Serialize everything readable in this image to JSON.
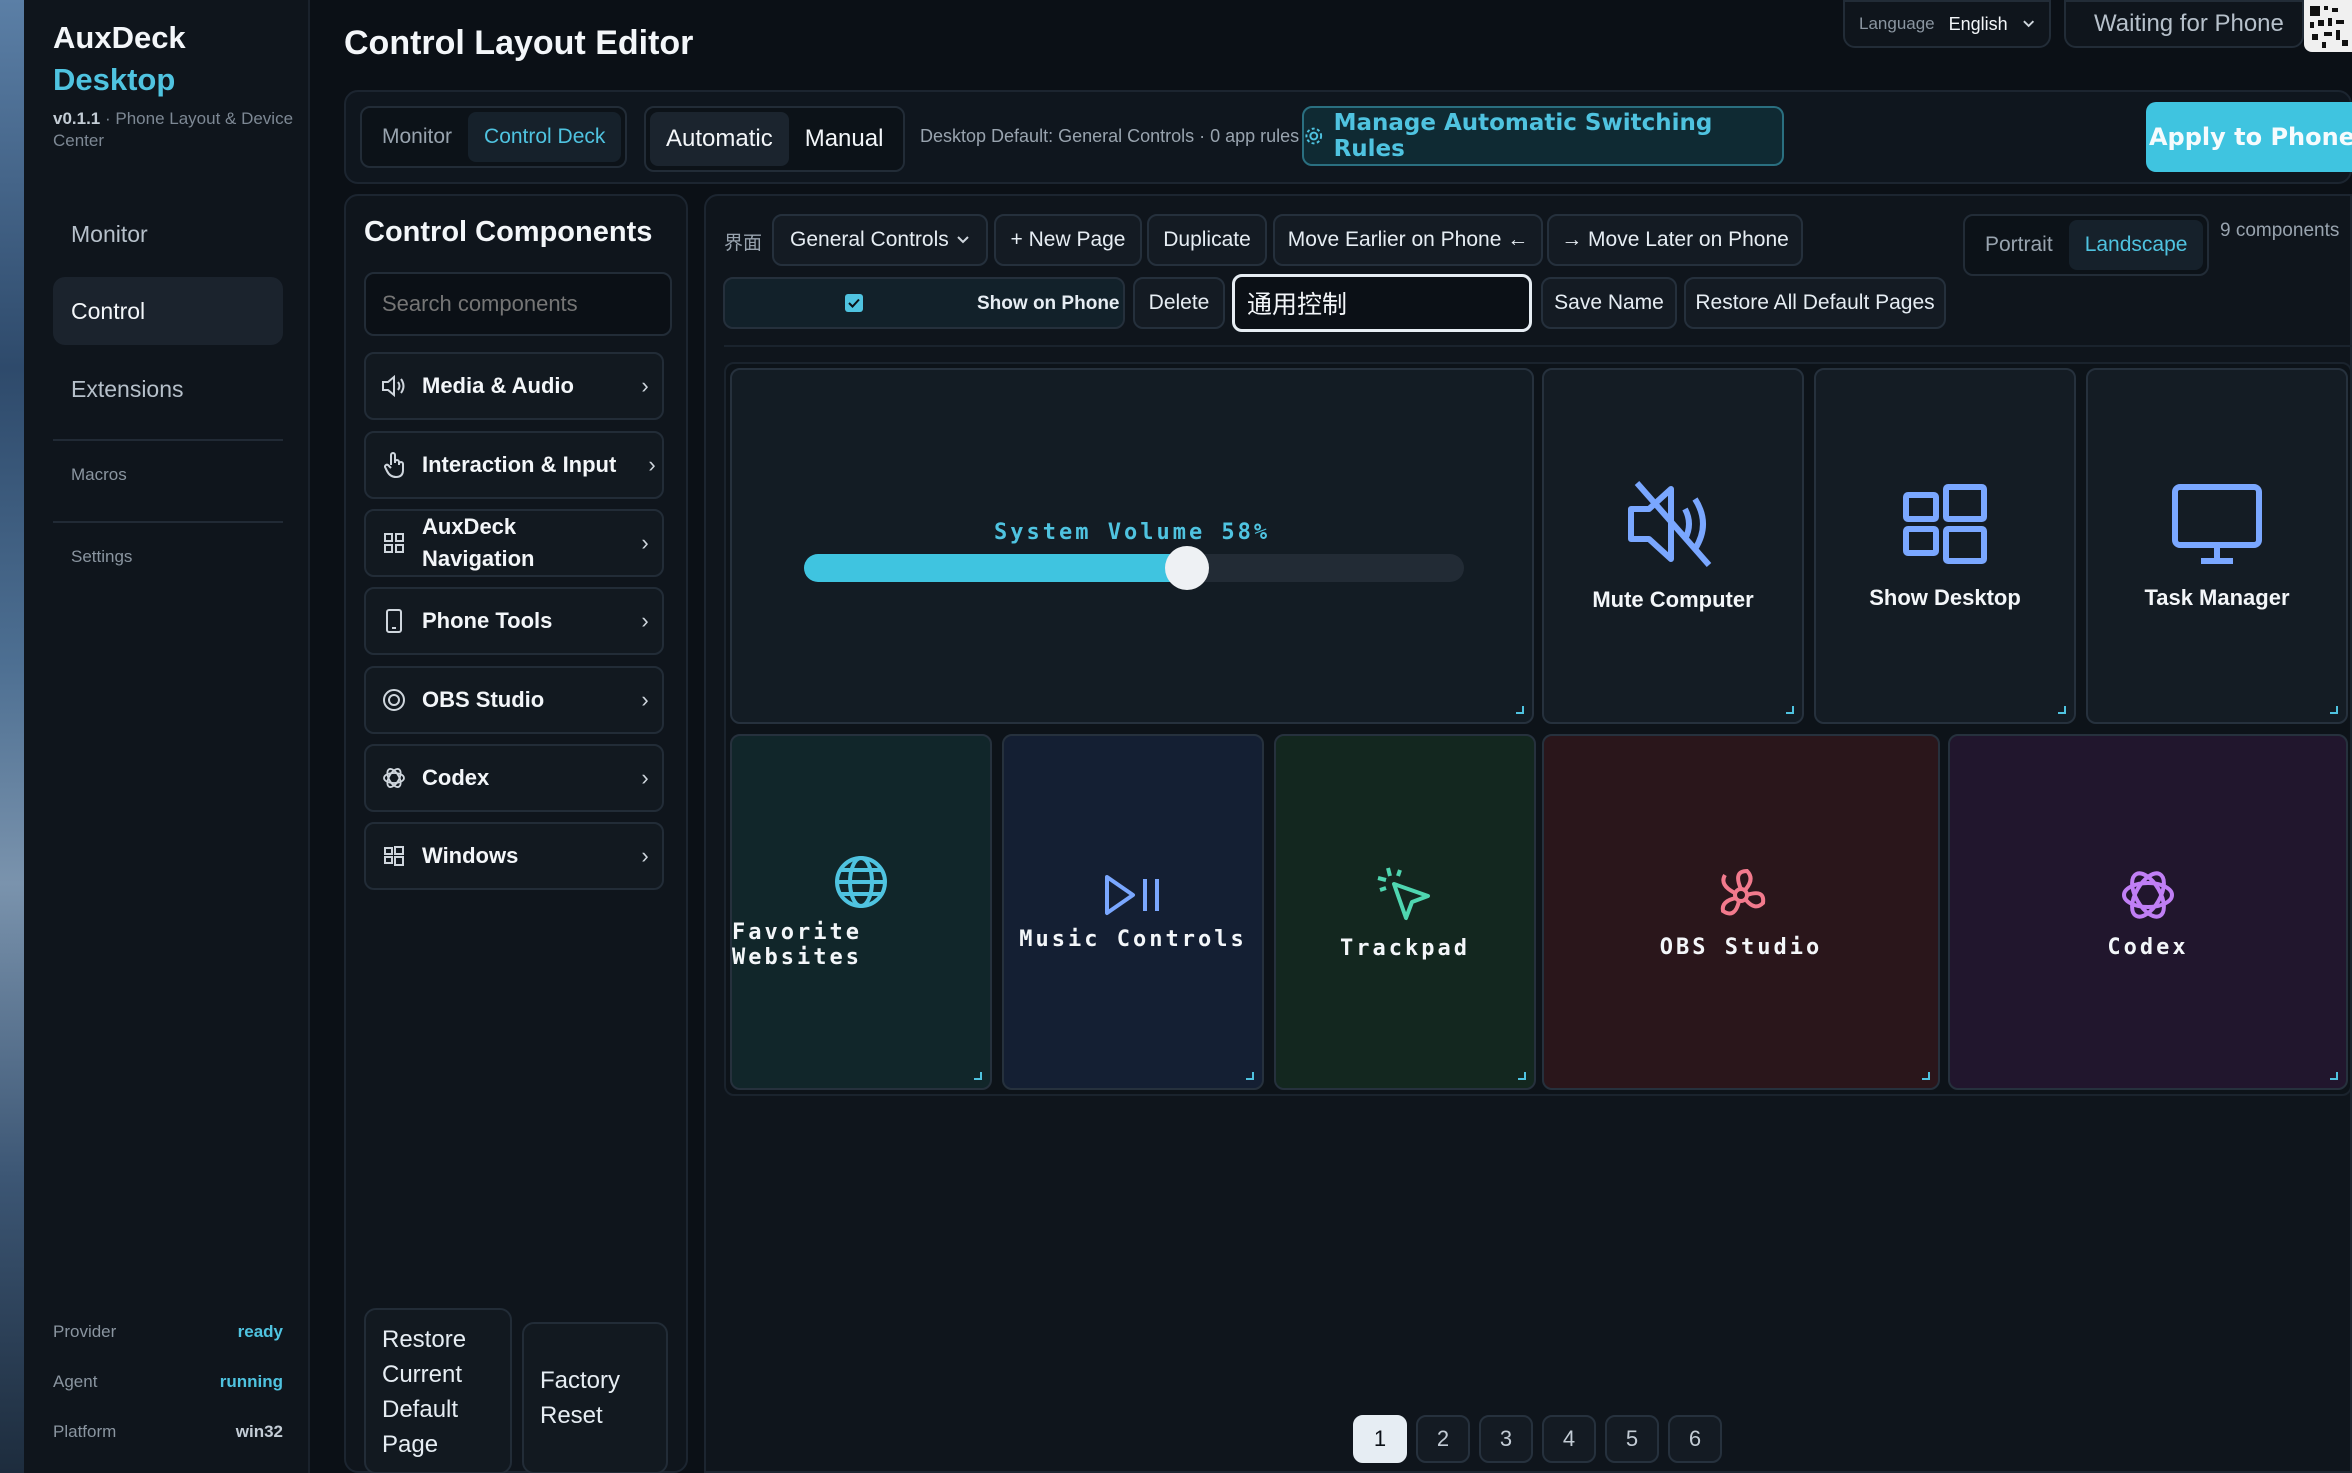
{
  "sidebar": {
    "brand_line1": "AuxDeck",
    "brand_line2": "Desktop",
    "version": "v0.1.1",
    "subtitle": " · Phone Layout & Device Center",
    "nav": [
      "Monitor",
      "Control",
      "Extensions"
    ],
    "nav_small": [
      "Macros",
      "Settings"
    ],
    "status": [
      {
        "key": "Provider",
        "value": "ready",
        "color": "#4fc3e0"
      },
      {
        "key": "Agent",
        "value": "running",
        "color": "#4fc3e0"
      },
      {
        "key": "Platform",
        "value": "win32",
        "color": "#c3ccd5"
      }
    ]
  },
  "header": {
    "title": "Control Layout Editor",
    "language_label": "Language",
    "language_value": "English",
    "phone_status": "Waiting for Phone"
  },
  "mode_bar": {
    "view_tabs": [
      "Monitor",
      "Control Deck"
    ],
    "switch_modes": [
      "Automatic",
      "Manual"
    ],
    "default_info": "Desktop Default: General Controls · 0 app rules",
    "manage_rules": "Manage Automatic Switching Rules",
    "apply": "Apply to Phone"
  },
  "components": {
    "title": "Control Components",
    "search_placeholder": "Search components",
    "categories": [
      {
        "label": "Media & Audio",
        "icon": "speaker-icon"
      },
      {
        "label": "Interaction & Input",
        "icon": "hand-pointer-icon"
      },
      {
        "label": "AuxDeck Navigation",
        "icon": "grid-icon"
      },
      {
        "label": "Phone Tools",
        "icon": "phone-icon"
      },
      {
        "label": "OBS Studio",
        "icon": "obs-icon"
      },
      {
        "label": "Codex",
        "icon": "codex-icon"
      },
      {
        "label": "Windows",
        "icon": "windows-icon"
      }
    ],
    "restore_current": "Restore Current Default Page",
    "factory_reset": "Factory Reset"
  },
  "toolbar": {
    "page_label": "界面",
    "page_select": "General Controls",
    "new_page": "+ New Page",
    "duplicate": "Duplicate",
    "move_earlier": "Move Earlier on Phone ←",
    "move_later": "→ Move Later on Phone",
    "orientation": [
      "Portrait",
      "Landscape"
    ],
    "component_count": "9 components",
    "show_on_phone": "Show on Phone",
    "show_on_phone_checked": true,
    "delete": "Delete",
    "page_name_value": "通用控制",
    "save_name": "Save Name",
    "restore_all": "Restore All Default Pages"
  },
  "tiles": {
    "volume": {
      "label": "System Volume 58%",
      "level": 0.58
    },
    "mute": "Mute Computer",
    "show_desktop": "Show Desktop",
    "task_manager": "Task Manager",
    "favorites": "Favorite Websites",
    "music": "Music Controls",
    "trackpad": "Trackpad",
    "obs": "OBS Studio",
    "codex": "Codex"
  },
  "pagination": [
    "1",
    "2",
    "3",
    "4",
    "5",
    "6"
  ],
  "colors": {
    "accent": "#4fc3e0",
    "tile_blue_icon": "#7aa7ff",
    "favorites_bg": "#11262a",
    "music_bg": "#141f33",
    "trackpad_bg": "#13271f",
    "obs_bg": "#2a161b",
    "codex_bg": "#21162d"
  }
}
